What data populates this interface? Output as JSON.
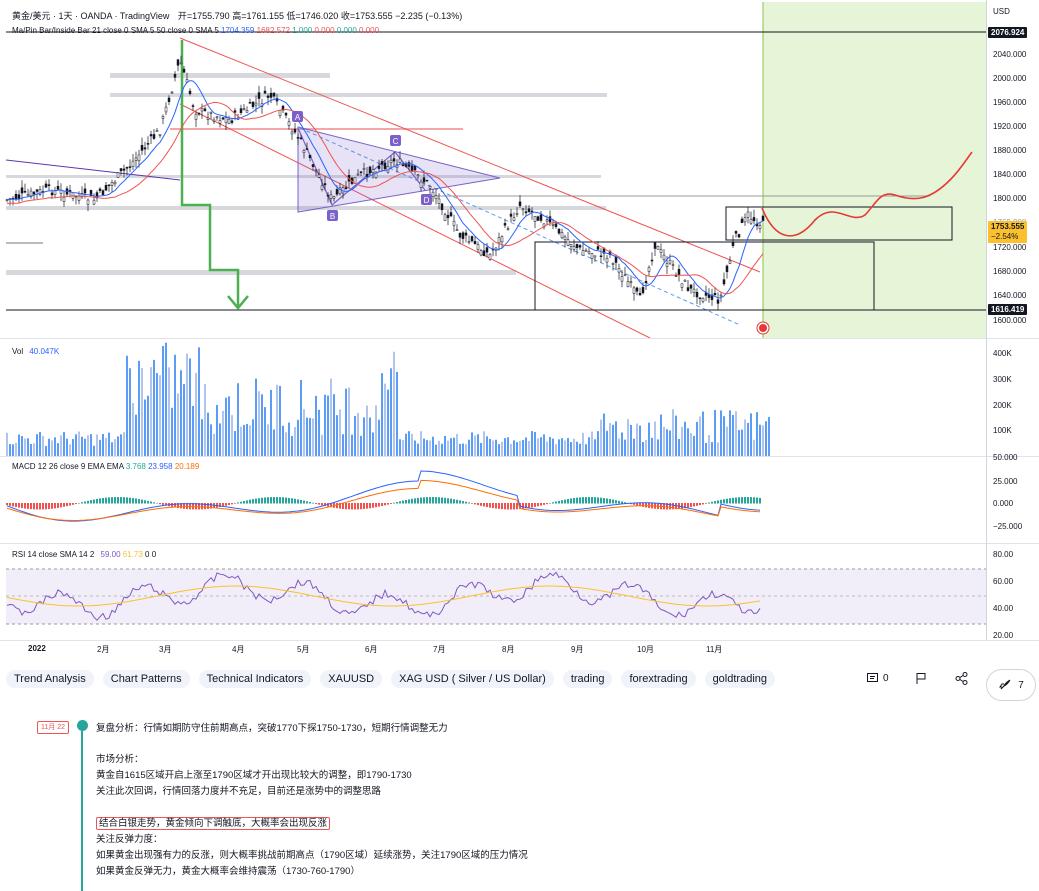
{
  "header": {
    "symbol": "黄金/美元 · 1天 · OANDA · TradingView",
    "open": "开=1755.790",
    "high": "高=1761.155",
    "low": "低=1746.020",
    "close": "收=1753.555",
    "change": "−2.235 (−0.13%)",
    "indicator": "Ma/Pin Bar/Inside Bar 21 close 0 SMA 5 50 close 0 SMA 5",
    "indicator_values": [
      "1704.359",
      "1682.572",
      "1.000",
      "0.000",
      "0.000",
      "0.000"
    ],
    "currency": "USD"
  },
  "price_axis": {
    "labels": [
      "2040.000",
      "2000.000",
      "1960.000",
      "1920.000",
      "1880.000",
      "1840.000",
      "1800.000",
      "1720.000",
      "1680.000",
      "1640.000",
      "1600.000"
    ],
    "tag_top": "2076.924",
    "tag_current": "1753.555",
    "tag_current_sub": "−2.54%",
    "tag_bottom": "1616.419",
    "partial": "1760.000"
  },
  "pattern_labels": [
    "A",
    "B",
    "C",
    "D"
  ],
  "volume": {
    "legend": "Vol",
    "value": "40.047K",
    "axis": [
      "400K",
      "300K",
      "200K",
      "100K"
    ]
  },
  "macd": {
    "legend": "MACD 12 26 close 9 EMA EMA",
    "values": [
      "3.768",
      "23.958",
      "20.189"
    ],
    "axis": [
      "50.000",
      "25.000",
      "0.000",
      "−25.000"
    ]
  },
  "rsi": {
    "legend": "RSI 14 close SMA 14 2",
    "values": [
      "59.00",
      "61.73",
      "0",
      "0"
    ],
    "axis": [
      "80.00",
      "60.00",
      "40.00",
      "20.00"
    ]
  },
  "time_axis": [
    "2022",
    "2月",
    "3月",
    "4月",
    "5月",
    "6月",
    "7月",
    "8月",
    "9月",
    "10月",
    "11月"
  ],
  "tags": [
    "Trend Analysis",
    "Chart Patterns",
    "Technical Indicators",
    "XAUUSD",
    "XAG USD ( Silver / US Dollar)",
    "trading",
    "forextrading",
    "goldtrading"
  ],
  "actions": {
    "comments_count": "0",
    "boosts_count": "7"
  },
  "note": {
    "date": "11月 22",
    "lines": [
      "复盘分析：行情如期防守住前期高点，突破1770下探1750-1730，短期行情调整无力",
      "市场分析：",
      "黄金自1615区域开启上涨至1790区域才开出现比较大的调整，即1790-1730",
      "关注此次回调，行情回落力度并不充足，目前还是涨势中的调整思路",
      "结合白银走势，黄金倾向下调触底，大概率会出现反涨",
      "关注反弹力度：",
      "如果黄金出现强有力的反涨，则大概率挑战前期高点（1790区域）延续涨势，关注1790区域的压力情况",
      "如果黄金反弹无力，黄金大概率会维持震荡（1730-760-1790）"
    ]
  },
  "colors": {
    "up": "#26a69a",
    "down": "#ef5350",
    "volume_blue": "#5b9cf6",
    "projection_bg": "#e6f4d8",
    "pattern": "#7b61c9",
    "accent_red": "#e53935",
    "arrow_green": "#4caf50"
  }
}
